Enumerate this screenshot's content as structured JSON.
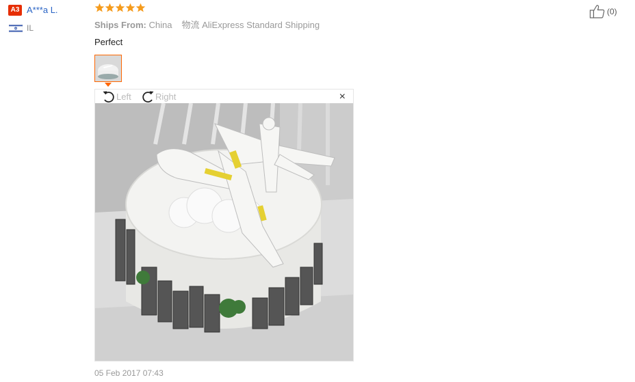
{
  "reviewer": {
    "level_badge": "A3",
    "name": "A***a L.",
    "country_code": "IL"
  },
  "review": {
    "rating_stars": 5,
    "ships_from_label": "Ships From:",
    "ships_from_value": "China",
    "shipping_label": "物流",
    "shipping_value": "AliExpress Standard Shipping",
    "text": "Perfect",
    "date": "05 Feb 2017 07:43"
  },
  "helpful": {
    "count": "(0)"
  },
  "viewer": {
    "rotate_left_label": "Left",
    "rotate_right_label": "Right",
    "close_symbol": "×",
    "photo_alt": "Photo of a white cake topped with a model airplane and surrounded by city skyline decorations"
  },
  "colors": {
    "accent": "#f60",
    "star": "#f59b1c",
    "link": "#2a64c5",
    "badge": "#e62e04"
  }
}
